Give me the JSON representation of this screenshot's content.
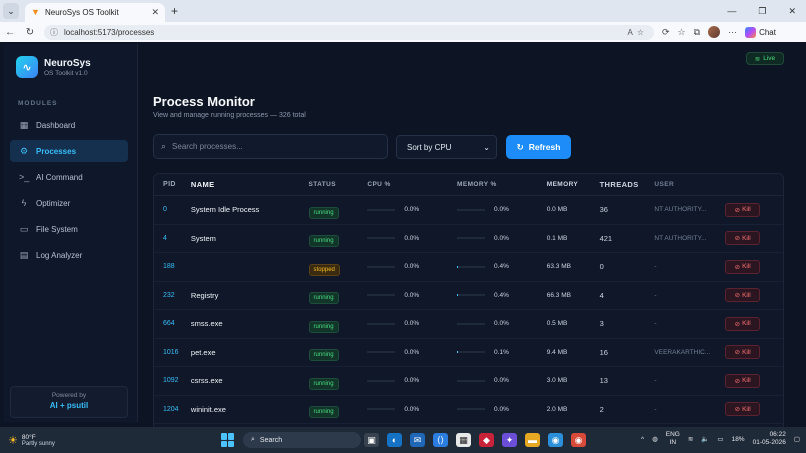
{
  "browser": {
    "tab_title": "NeuroSys OS Toolkit",
    "url": "localhost:5173/processes",
    "copilot_label": "Chat"
  },
  "app": {
    "name": "NeuroSys",
    "version": "OS Toolkit v1.0",
    "live_label": "Live",
    "modules_label": "MODULES",
    "menu": [
      {
        "label": "Dashboard",
        "icon": "grid-icon"
      },
      {
        "label": "Processes",
        "icon": "cpu-icon",
        "active": true
      },
      {
        "label": "AI Command",
        "icon": "terminal-icon"
      },
      {
        "label": "Optimizer",
        "icon": "bolt-icon"
      },
      {
        "label": "File System",
        "icon": "folder-icon"
      },
      {
        "label": "Log Analyzer",
        "icon": "document-icon"
      }
    ],
    "powered_by": "Powered by",
    "powered_by_value": "AI + psutil"
  },
  "page": {
    "title": "Process Monitor",
    "subtitle": "View and manage running processes — 326 total",
    "search_placeholder": "Search processes...",
    "sort_value": "Sort by CPU",
    "refresh_label": "Refresh"
  },
  "table": {
    "headers": [
      "PID",
      "NAME",
      "STATUS",
      "CPU %",
      "MEMORY %",
      "MEMORY",
      "THREADS",
      "USER"
    ],
    "kill_label": "Kill",
    "rows": [
      {
        "pid": "0",
        "name": "System Idle Process",
        "status": "running",
        "cpu": "0.0%",
        "cpu_frac": 0.0,
        "mem_pct": "0.0%",
        "mem_frac": 0.0,
        "memory": "0.0 MB",
        "threads": "36",
        "user": "NT AUTHORITY..."
      },
      {
        "pid": "4",
        "name": "System",
        "status": "running",
        "cpu": "0.0%",
        "cpu_frac": 0.0,
        "mem_pct": "0.0%",
        "mem_frac": 0.0,
        "memory": "0.1 MB",
        "threads": "421",
        "user": "NT AUTHORITY..."
      },
      {
        "pid": "188",
        "name": "",
        "status": "stopped",
        "cpu": "0.0%",
        "cpu_frac": 0.0,
        "mem_pct": "0.4%",
        "mem_frac": 0.04,
        "memory": "63.3 MB",
        "threads": "0",
        "user": "-"
      },
      {
        "pid": "232",
        "name": "Registry",
        "status": "running",
        "cpu": "0.0%",
        "cpu_frac": 0.0,
        "mem_pct": "0.4%",
        "mem_frac": 0.04,
        "memory": "66.3 MB",
        "threads": "4",
        "user": "-"
      },
      {
        "pid": "664",
        "name": "smss.exe",
        "status": "running",
        "cpu": "0.0%",
        "cpu_frac": 0.0,
        "mem_pct": "0.0%",
        "mem_frac": 0.0,
        "memory": "0.5 MB",
        "threads": "3",
        "user": "-"
      },
      {
        "pid": "1016",
        "name": "pet.exe",
        "status": "running",
        "cpu": "0.0%",
        "cpu_frac": 0.0,
        "mem_pct": "0.1%",
        "mem_frac": 0.01,
        "memory": "9.4 MB",
        "threads": "16",
        "user": "VEERAKARTHIC..."
      },
      {
        "pid": "1092",
        "name": "csrss.exe",
        "status": "running",
        "cpu": "0.0%",
        "cpu_frac": 0.0,
        "mem_pct": "0.0%",
        "mem_frac": 0.0,
        "memory": "3.0 MB",
        "threads": "13",
        "user": "-"
      },
      {
        "pid": "1204",
        "name": "wininit.exe",
        "status": "running",
        "cpu": "0.0%",
        "cpu_frac": 0.0,
        "mem_pct": "0.0%",
        "mem_frac": 0.0,
        "memory": "2.0 MB",
        "threads": "2",
        "user": "-"
      }
    ]
  },
  "taskbar": {
    "temperature": "80°F",
    "weather": "Partly sunny",
    "search_label": "Search",
    "lang_top": "ENG",
    "lang_bottom": "IN",
    "battery": "18%",
    "time": "06:22",
    "date": "01-05-2026"
  },
  "colors": {
    "accent": "#38bdf8",
    "running": "#4ade80",
    "stopped": "#fbbf24",
    "danger": "#f87171"
  }
}
